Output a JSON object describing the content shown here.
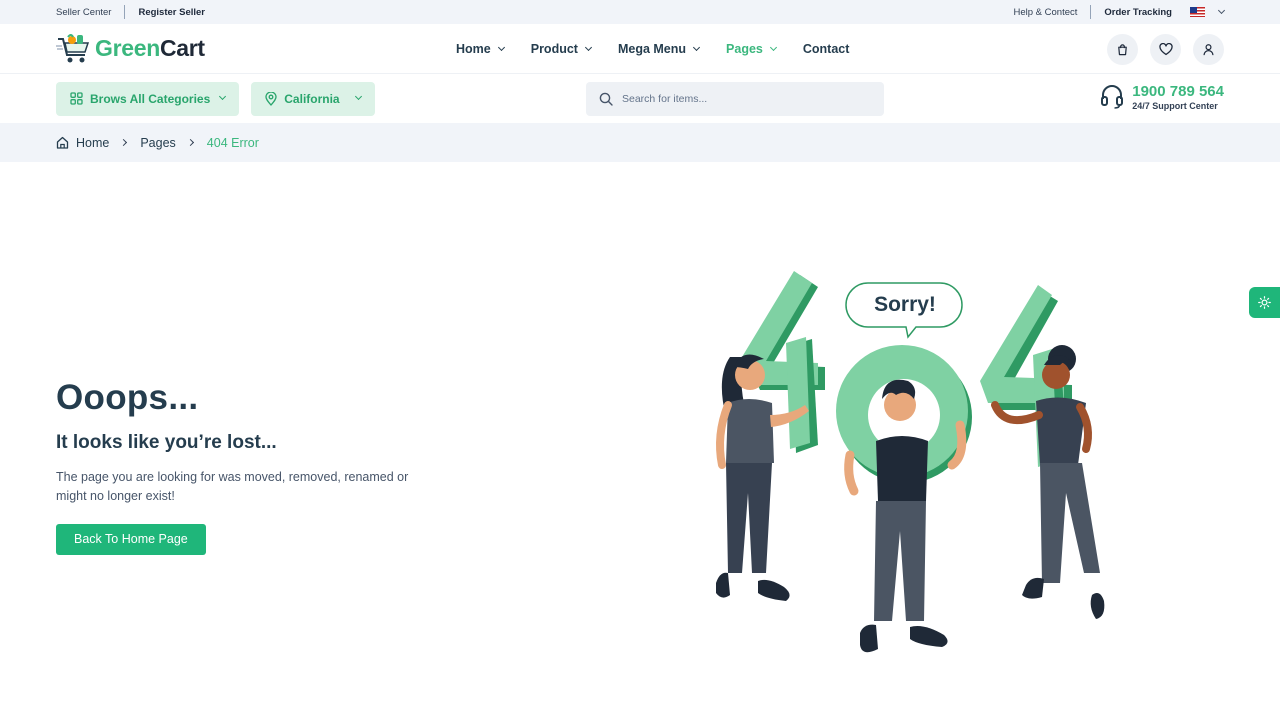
{
  "topbar": {
    "seller_center": "Seller Center",
    "register_seller": "Register Seller",
    "help_contact": "Help & Contect",
    "order_tracking": "Order Tracking"
  },
  "header": {
    "logo_part1": "Green",
    "logo_part2": "Cart",
    "nav": [
      {
        "label": "Home",
        "has_dropdown": true
      },
      {
        "label": "Product",
        "has_dropdown": true
      },
      {
        "label": "Mega Menu",
        "has_dropdown": true
      },
      {
        "label": "Pages",
        "has_dropdown": true,
        "active": true
      },
      {
        "label": "Contact",
        "has_dropdown": false
      }
    ],
    "icons": [
      "shopping-bag-icon",
      "heart-icon",
      "user-icon"
    ]
  },
  "catrow": {
    "categories_label": "Brows All Categories",
    "location_label": "California",
    "search_placeholder": "Search for items...",
    "support_phone": "1900 789 564",
    "support_text": "24/7 Support Center"
  },
  "breadcrumb": {
    "items": [
      "Home",
      "Pages"
    ],
    "current": "404 Error"
  },
  "main": {
    "title": "Ooops...",
    "subtitle": "It looks like you’re lost...",
    "description": "The page you are looking for was moved, removed, renamed or might no longer exist!",
    "button_label": "Back To Home Page"
  },
  "illustration": {
    "bubble_text": "Sorry!"
  },
  "colors": {
    "brand": "#3bb77e",
    "button": "#1fb67a",
    "text_dark": "#253d4e",
    "pill_bg": "#dcf2e7"
  }
}
